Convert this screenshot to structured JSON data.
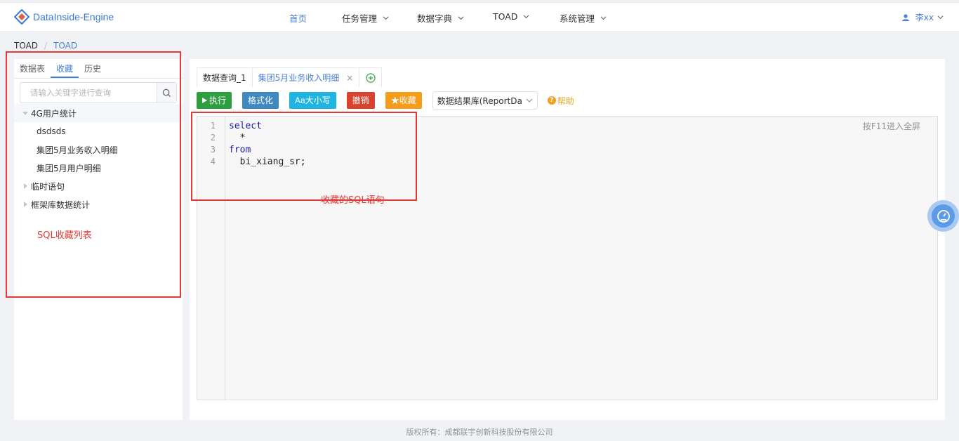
{
  "app": {
    "logo_text": "DataInside-Engine"
  },
  "nav": {
    "items": [
      {
        "label": "首页",
        "has_dropdown": false
      },
      {
        "label": "任务管理",
        "has_dropdown": true
      },
      {
        "label": "数据字典",
        "has_dropdown": true
      },
      {
        "label": "TOAD",
        "has_dropdown": true
      },
      {
        "label": "系统管理",
        "has_dropdown": true
      }
    ],
    "user": "李xx"
  },
  "breadcrumb": {
    "root": "TOAD",
    "separator": "/",
    "current": "TOAD"
  },
  "left": {
    "tabs": [
      "数据表",
      "收藏",
      "历史"
    ],
    "active_tab": "收藏",
    "search_placeholder": "请输入关键字进行查询",
    "tree": [
      {
        "label": "4G用户统计",
        "expanded": true,
        "children": [
          "dsdsds",
          "集团5月业务收入明细",
          "集团5月用户明细"
        ]
      },
      {
        "label": "临时语句",
        "expanded": false
      },
      {
        "label": "框架库数据统计",
        "expanded": false
      }
    ],
    "annotation": "SQL收藏列表"
  },
  "editor": {
    "tabs": [
      {
        "label": "数据查询_1",
        "closable": false
      },
      {
        "label": "集团5月业务收入明细",
        "closable": true
      }
    ],
    "toolbar": {
      "execute": "执行",
      "format": "格式化",
      "case": "Aa大小写",
      "undo": "撤销",
      "favorite": "★收藏",
      "datasource": "数据结果库(ReportDat",
      "help": "帮助"
    },
    "line_numbers": [
      "1",
      "2",
      "3",
      "4"
    ],
    "code": {
      "l1": "select",
      "l2": "  *",
      "l3": "from",
      "l4": "  bi_xiang_sr;"
    },
    "fullscreen_hint": "按F11进入全屏",
    "annotation": "收藏的SQL语句"
  },
  "colors": {
    "accent": "#4a7fd6",
    "execute": "#2e9e3e",
    "format": "#3f88c0",
    "case": "#1fb5e0",
    "undo": "#d9422e",
    "favorite": "#f59c1a",
    "annotation": "#e53935"
  },
  "footer": "版权所有：成都联宇创新科技股份有限公司"
}
